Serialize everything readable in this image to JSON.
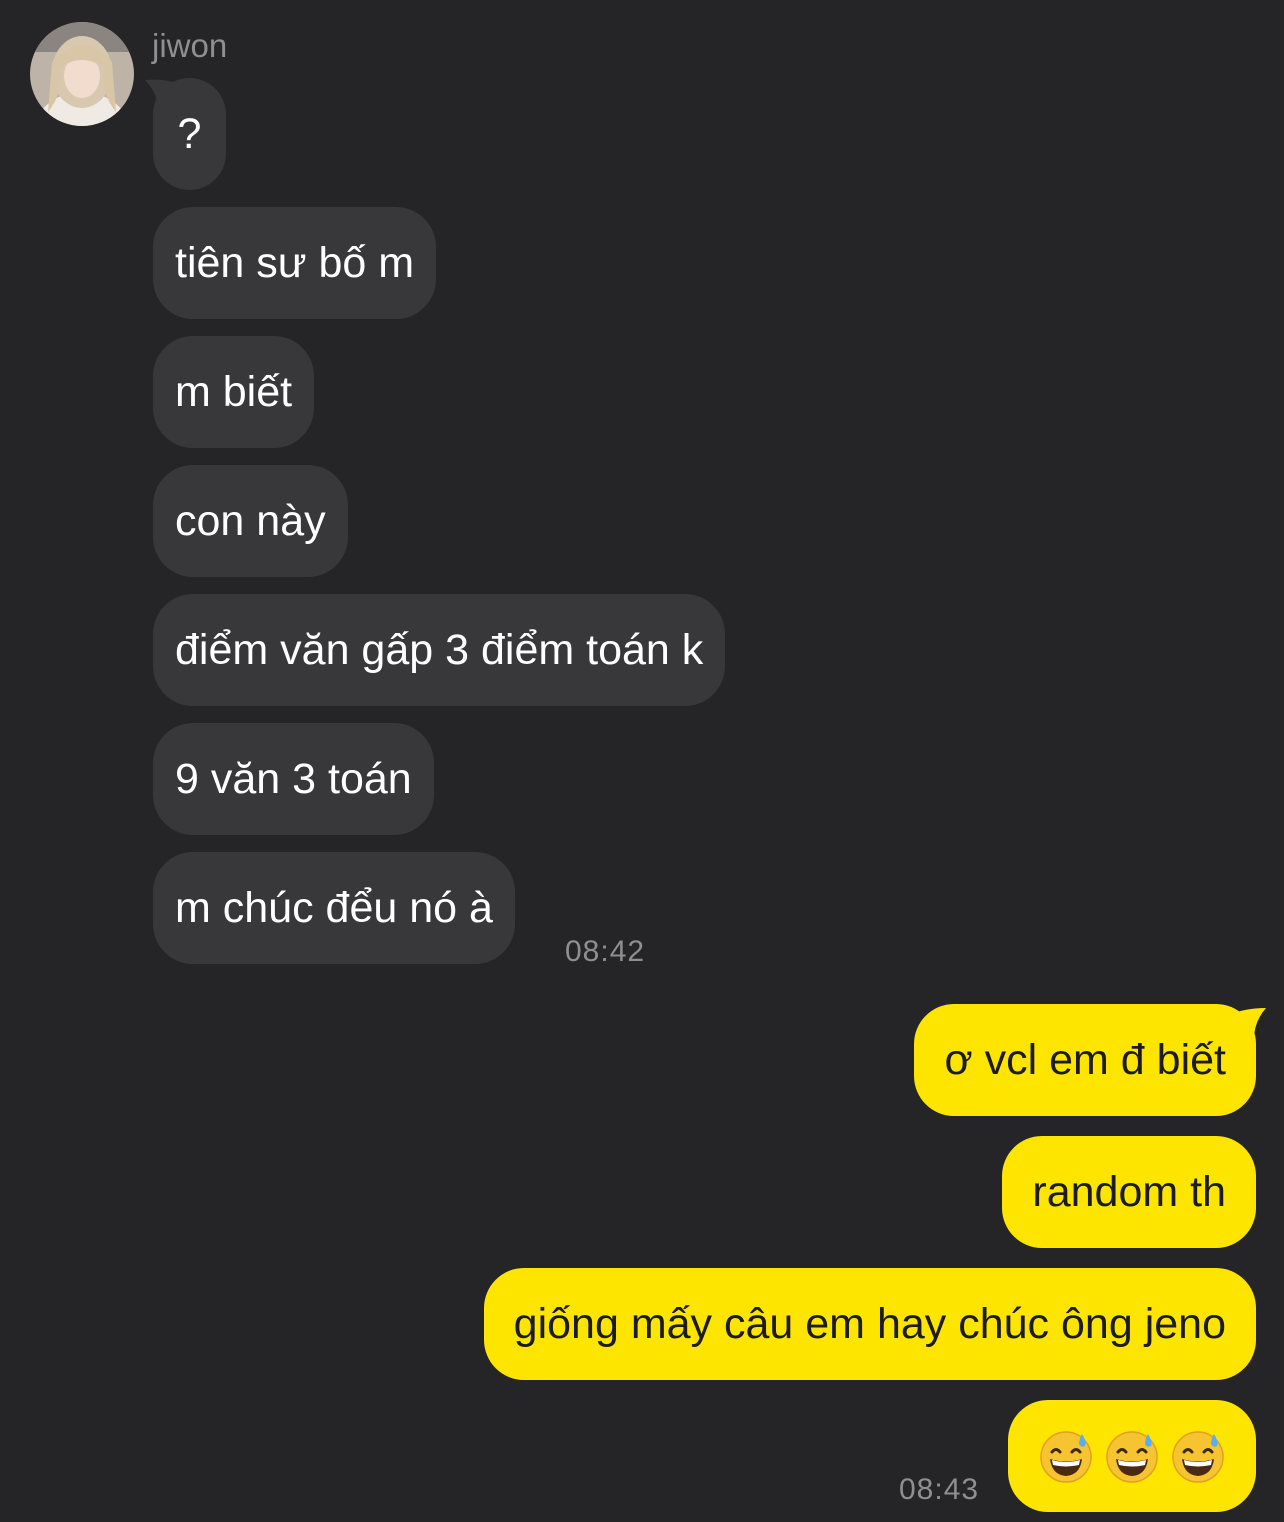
{
  "chat": {
    "sender": {
      "name": "jiwon",
      "avatar_icon": "profile-photo-avatar"
    },
    "incoming_messages": [
      {
        "text": "?"
      },
      {
        "text": "tiên sư bố m"
      },
      {
        "text": "m biết"
      },
      {
        "text": "con này"
      },
      {
        "text": "điểm văn gấp 3 điểm toán k"
      },
      {
        "text": "9 văn 3 toán"
      },
      {
        "text": "m chúc đểu nó à"
      }
    ],
    "incoming_time": "08:42",
    "outgoing_messages": [
      {
        "text": "ơ vcl em đ biết"
      },
      {
        "text": "random th"
      },
      {
        "text": "giống mấy câu em hay chúc ông jeno"
      },
      {
        "emoji": [
          "grinning-face-with-sweat",
          "grinning-face-with-sweat",
          "grinning-face-with-sweat"
        ]
      }
    ],
    "outgoing_time": "08:43"
  },
  "colors": {
    "background": "#252527",
    "incoming_bubble": "#38383b",
    "outgoing_bubble": "#fee500",
    "timestamp": "#8e8e93"
  }
}
